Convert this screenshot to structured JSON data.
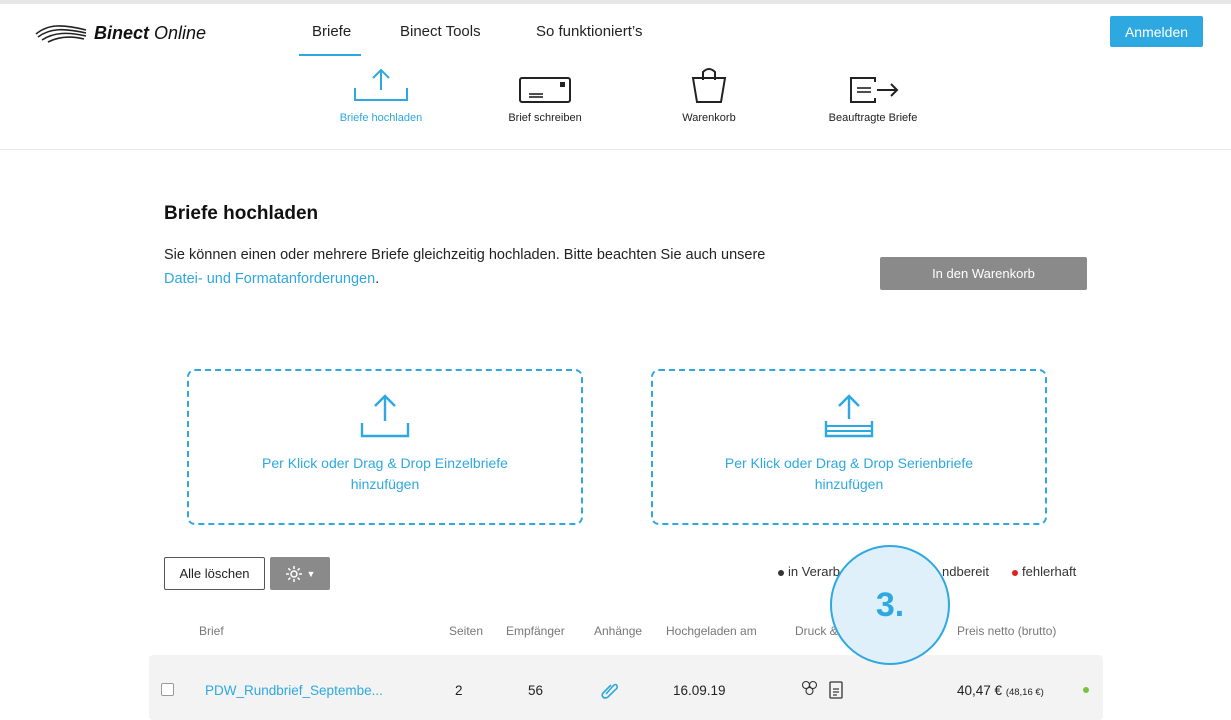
{
  "brand": {
    "logo_text_bold": "Binect",
    "logo_text_rest": " Online"
  },
  "nav": {
    "items": [
      {
        "label": "Briefe"
      },
      {
        "label": "Binect Tools"
      },
      {
        "label": "So funktioniert’s"
      }
    ],
    "login_label": "Anmelden"
  },
  "steps": [
    {
      "label": "Briefe hochladen",
      "icon": "upload-tray-icon"
    },
    {
      "label": "Brief schreiben",
      "icon": "envelope-icon"
    },
    {
      "label": "Warenkorb",
      "icon": "shopping-bag-icon"
    },
    {
      "label": "Beauftragte Briefe",
      "icon": "letter-sent-icon"
    }
  ],
  "main": {
    "title": "Briefe hochladen",
    "intro": "Sie können einen oder mehrere Briefe gleichzeitig hochladen. Bitte beachten Sie auch unsere",
    "intro_link": "Datei- und Formatanforderungen",
    "intro_end": ".",
    "cart_button": "In den Warenkorb"
  },
  "dropzones": [
    {
      "label": "Per Klick oder Drag & Drop Einzelbriefe hinzufügen"
    },
    {
      "label": "Per Klick oder Drag & Drop Serienbriefe hinzufügen"
    }
  ],
  "toolbar": {
    "clear_label": "Alle löschen"
  },
  "legend": [
    {
      "label": "in Verarb",
      "color": "#333333"
    },
    {
      "label": "ndbereit",
      "color": "#7ac142"
    },
    {
      "label": "fehlerhaft",
      "color": "#e02020"
    }
  ],
  "overlay": {
    "step_number": "3."
  },
  "table": {
    "headers": [
      "Brief",
      "Seiten",
      "Empfänger",
      "Anhänge",
      "Hochgeladen am",
      "Druck &",
      "Preis netto (brutto)"
    ],
    "rows": [
      {
        "name": "PDW_Rundbrief_Septembe...",
        "pages": "2",
        "recipients": "56",
        "date": "16.09.19",
        "price": "40,47 €",
        "price_gross": "(48,16 €)",
        "status_color": "#7ac142"
      }
    ]
  },
  "colors": {
    "accent": "#2ea8e0",
    "gray_button": "#8a8a8a"
  }
}
